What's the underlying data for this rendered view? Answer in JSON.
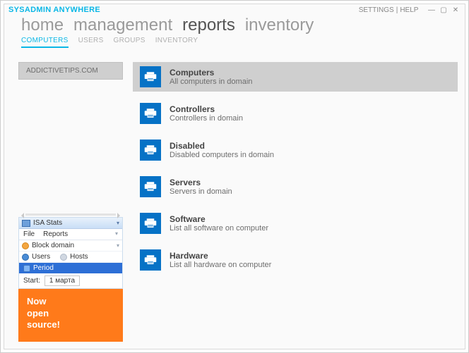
{
  "titlebar": {
    "app": "SYSADMIN ANYWHERE",
    "settings": "SETTINGS",
    "help": "HELP"
  },
  "nav": {
    "items": [
      "home",
      "management",
      "reports",
      "inventory"
    ],
    "activeIndex": 2
  },
  "subnav": {
    "items": [
      "COMPUTERS",
      "USERS",
      "GROUPS",
      "INVENTORY"
    ],
    "activeIndex": 0
  },
  "side": {
    "header": "ADDICTIVETIPS.COM"
  },
  "widget": {
    "title": "ISA Stats",
    "menu": [
      "File",
      "Reports"
    ],
    "row1": "Block domain",
    "tabs": [
      "Users",
      "Hosts"
    ],
    "period": "Period",
    "startLabel": "Start:",
    "startValue": "1   марта"
  },
  "banner": {
    "line1": "Now",
    "line2": "open",
    "line3": "source!"
  },
  "reports": [
    {
      "title": "Computers",
      "desc": "All computers in domain",
      "selected": true
    },
    {
      "title": "Controllers",
      "desc": "Controllers in domain",
      "selected": false
    },
    {
      "title": "Disabled",
      "desc": "Disabled computers in domain",
      "selected": false
    },
    {
      "title": "Servers",
      "desc": "Servers in domain",
      "selected": false
    },
    {
      "title": "Software",
      "desc": "List all software on computer",
      "selected": false
    },
    {
      "title": "Hardware",
      "desc": "List all hardware on computer",
      "selected": false
    }
  ]
}
